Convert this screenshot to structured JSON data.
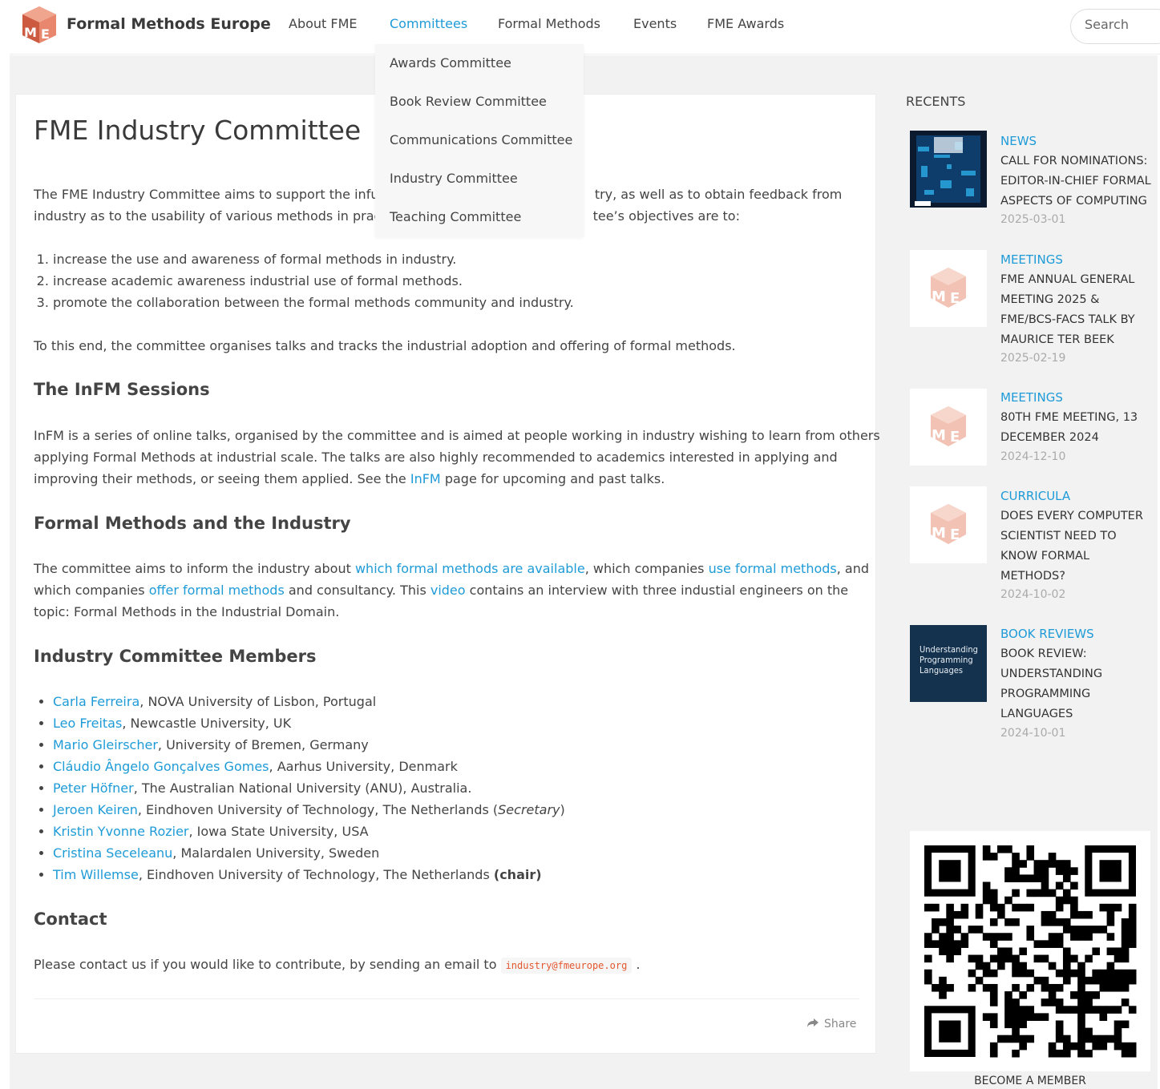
{
  "header": {
    "brand": "Formal Methods Europe",
    "nav": [
      "About FME",
      "Committees",
      "Formal Methods",
      "Events",
      "FME Awards"
    ],
    "search_placeholder": "Search"
  },
  "dropdown": {
    "items": [
      "Awards Committee",
      "Book Review Committee",
      "Communications Committee",
      "Industry Committee",
      "Teaching Committee"
    ]
  },
  "main": {
    "title": "FME Industry Committee",
    "intro_line1a": "The FME Industry Committee aims to support the infus",
    "intro_line1b": "try, as well as to obtain feedback from",
    "intro_line2a": "industry as to the usability of various methods in pract",
    "intro_line2b": "tee’s objectives are to:",
    "objectives": [
      "increase the use and awareness of formal methods in industry.",
      "increase academic awareness industrial use of formal methods.",
      "promote the collaboration between the formal methods community and industry."
    ],
    "to_this_end": "To this end, the committee organises talks and tracks the industrial adoption and offering of formal methods.",
    "infm_heading": "The InFM Sessions",
    "infm_p1": "InFM is a series of online talks, organised by the committee and is aimed at people working in industry wishing to learn from others",
    "infm_p2": "applying Formal Methods at industrial scale. The talks are also highly recommended to academics interested in applying and",
    "infm_p3a": "improving their methods, or seeing them applied. See the ",
    "infm_link": "InFM",
    "infm_p3b": " page for upcoming and past talks.",
    "fm_heading": "Formal Methods and the Industry",
    "fm_p1a": "The committee aims to inform the industry about ",
    "fm_link1": "which formal methods are available",
    "fm_p1b": ", which companies ",
    "fm_link2": "use formal methods",
    "fm_p1c": ", and",
    "fm_p2a": "which companies ",
    "fm_link3": "offer formal methods",
    "fm_p2b": " and consultancy. This ",
    "fm_link4": "video",
    "fm_p2c": " contains an interview with three industial engineers on the",
    "fm_p3": "topic: Formal Methods in the Industrial Domain.",
    "members_heading": "Industry Committee Members",
    "members": [
      {
        "name": "Carla Ferreira",
        "rest": ", NOVA University of Lisbon, Portugal",
        "extra": ""
      },
      {
        "name": "Leo Freitas",
        "rest": ", Newcastle University, UK",
        "extra": ""
      },
      {
        "name": "Mario Gleirscher",
        "rest": ", University of Bremen, Germany",
        "extra": ""
      },
      {
        "name": "Cláudio Ângelo Gonçalves Gomes",
        "rest": ", Aarhus University, Denmark",
        "extra": ""
      },
      {
        "name": "Peter Höfner",
        "rest": ", The Australian National University (ANU), Australia.",
        "extra": ""
      },
      {
        "name": "Jeroen Keiren",
        "rest": ", Eindhoven University of Technology, The Netherlands (",
        "extra": "Secretary",
        "tail": ")"
      },
      {
        "name": "Kristin Yvonne Rozier",
        "rest": ", Iowa State University, USA",
        "extra": ""
      },
      {
        "name": "Cristina Seceleanu",
        "rest": ", Malardalen University, Sweden",
        "extra": ""
      },
      {
        "name": "Tim Willemse",
        "rest": ", Eindhoven University of Technology, The Netherlands ",
        "extra": "(chair)"
      }
    ],
    "contact_heading": "Contact",
    "contact_text": "Please contact us if you would like to contribute, by sending an email to",
    "contact_email": "industry@fmeurope.org",
    "contact_end": ".",
    "share": "Share"
  },
  "sidebar": {
    "recents_title": "RECENTS",
    "posts": [
      {
        "category": "NEWS",
        "title": "CALL FOR NOMINATIONS: EDITOR-IN-CHIEF FORMAL ASPECTS OF COMPUTING",
        "date": "2025-03-01"
      },
      {
        "category": "MEETINGS",
        "title": "FME ANNUAL GENERAL MEETING 2025 & FME/BCS-FACS TALK BY MAURICE TER BEEK",
        "date": "2025-02-19"
      },
      {
        "category": "MEETINGS",
        "title": "80TH FME MEETING, 13 DECEMBER 2024",
        "date": "2024-12-10"
      },
      {
        "category": "CURRICULA",
        "title": "DOES EVERY COMPUTER SCIENTIST NEED TO KNOW FORMAL METHODS?",
        "date": "2024-10-02"
      },
      {
        "category": "BOOK REVIEWS",
        "title": "BOOK REVIEW: UNDERSTANDING PROGRAMMING LANGUAGES",
        "date": "2024-10-01"
      }
    ],
    "book_cover_text": "Understanding Programming Languages",
    "become_member": "BECOME A MEMBER"
  },
  "colors": {
    "accent": "#1e9bd7",
    "logo": "#d9634a",
    "code": "#e4572e"
  }
}
